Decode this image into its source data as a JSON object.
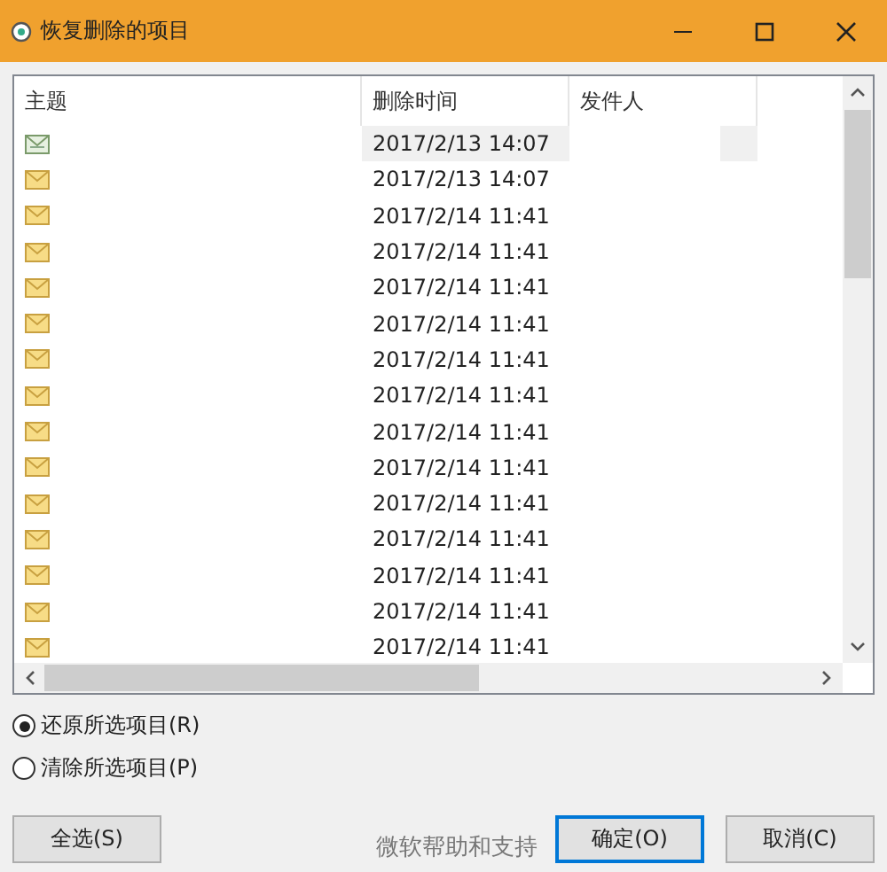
{
  "window": {
    "title": "恢复删除的项目"
  },
  "table": {
    "columns": [
      "主题",
      "删除时间",
      "发件人"
    ],
    "rows": [
      {
        "kind": "read",
        "deleted": "2017/2/13 14:07",
        "selected": true
      },
      {
        "kind": "mail",
        "deleted": "2017/2/13 14:07",
        "selected": false
      },
      {
        "kind": "mail",
        "deleted": "2017/2/14 11:41",
        "selected": false
      },
      {
        "kind": "mail",
        "deleted": "2017/2/14 11:41",
        "selected": false
      },
      {
        "kind": "mail",
        "deleted": "2017/2/14 11:41",
        "selected": false
      },
      {
        "kind": "mail",
        "deleted": "2017/2/14 11:41",
        "selected": false
      },
      {
        "kind": "mail",
        "deleted": "2017/2/14 11:41",
        "selected": false
      },
      {
        "kind": "mail",
        "deleted": "2017/2/14 11:41",
        "selected": false
      },
      {
        "kind": "mail",
        "deleted": "2017/2/14 11:41",
        "selected": false
      },
      {
        "kind": "mail",
        "deleted": "2017/2/14 11:41",
        "selected": false
      },
      {
        "kind": "mail",
        "deleted": "2017/2/14 11:41",
        "selected": false
      },
      {
        "kind": "mail",
        "deleted": "2017/2/14 11:41",
        "selected": false
      },
      {
        "kind": "mail",
        "deleted": "2017/2/14 11:41",
        "selected": false
      },
      {
        "kind": "mail",
        "deleted": "2017/2/14 11:41",
        "selected": false
      },
      {
        "kind": "mail",
        "deleted": "2017/2/14 11:41",
        "selected": false
      }
    ]
  },
  "options": [
    {
      "label": "还原所选项目(R)",
      "selected": true
    },
    {
      "label": "清除所选项目(P)",
      "selected": false
    }
  ],
  "buttons": {
    "select_all": "全选(S)",
    "help_link": "微软帮助和支持",
    "ok": "确定(O)",
    "cancel": "取消(C)"
  }
}
